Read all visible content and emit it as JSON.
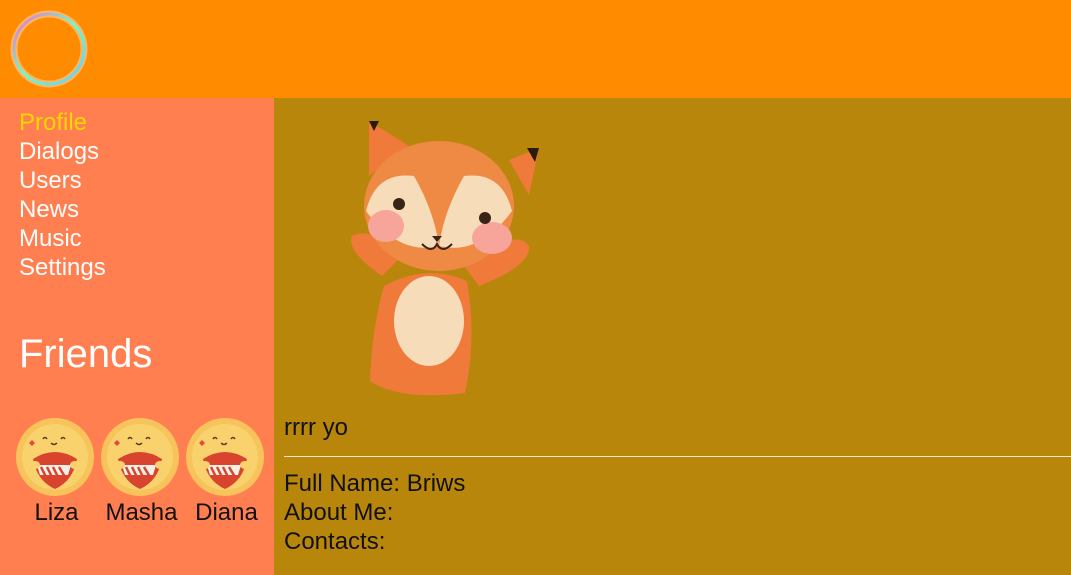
{
  "header": {
    "logo_icon": "ring-logo-icon"
  },
  "nav": {
    "items": [
      {
        "label": "Profile",
        "active": true
      },
      {
        "label": "Dialogs",
        "active": false
      },
      {
        "label": "Users",
        "active": false
      },
      {
        "label": "News",
        "active": false
      },
      {
        "label": "Music",
        "active": false
      },
      {
        "label": "Settings",
        "active": false
      }
    ]
  },
  "friends": {
    "title": "Friends",
    "list": [
      {
        "name": "Liza",
        "avatar_icon": "heart-chick-avatar-icon"
      },
      {
        "name": "Masha",
        "avatar_icon": "heart-chick-avatar-icon"
      },
      {
        "name": "Diana",
        "avatar_icon": "heart-chick-avatar-icon"
      }
    ]
  },
  "profile": {
    "image_icon": "fox-puppet-icon",
    "status": "rrrr yo",
    "full_name_label": "Full Name: Briws",
    "about_label": "About Me:",
    "contacts_label": "Contacts:"
  },
  "colors": {
    "header": "#ff8c00",
    "sidebar": "#ff7f50",
    "main": "#b8860b",
    "active_nav": "#ffd700"
  }
}
